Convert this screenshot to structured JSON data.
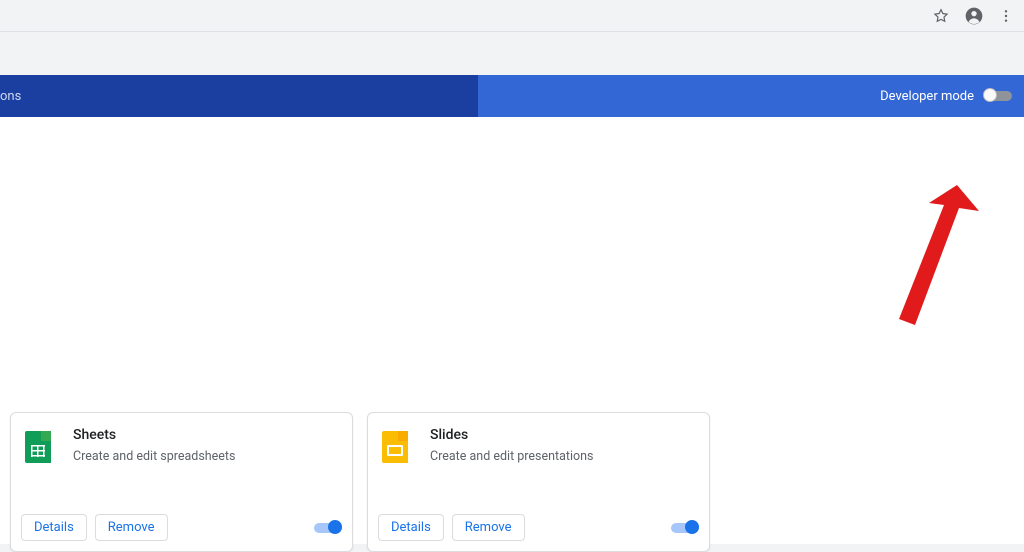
{
  "omnibox": {
    "star": "star-icon",
    "profile": "profile-icon",
    "menu": "menu-icon"
  },
  "header": {
    "search_fragment": "ons",
    "dev_mode_label": "Developer mode",
    "dev_mode_on": false
  },
  "cards": [
    {
      "icon": "sheets",
      "title": "Sheets",
      "description": "Create and edit spreadsheets",
      "details_label": "Details",
      "remove_label": "Remove",
      "enabled": true
    },
    {
      "icon": "slides",
      "title": "Slides",
      "description": "Create and edit presentations",
      "details_label": "Details",
      "remove_label": "Remove",
      "enabled": true
    }
  ]
}
